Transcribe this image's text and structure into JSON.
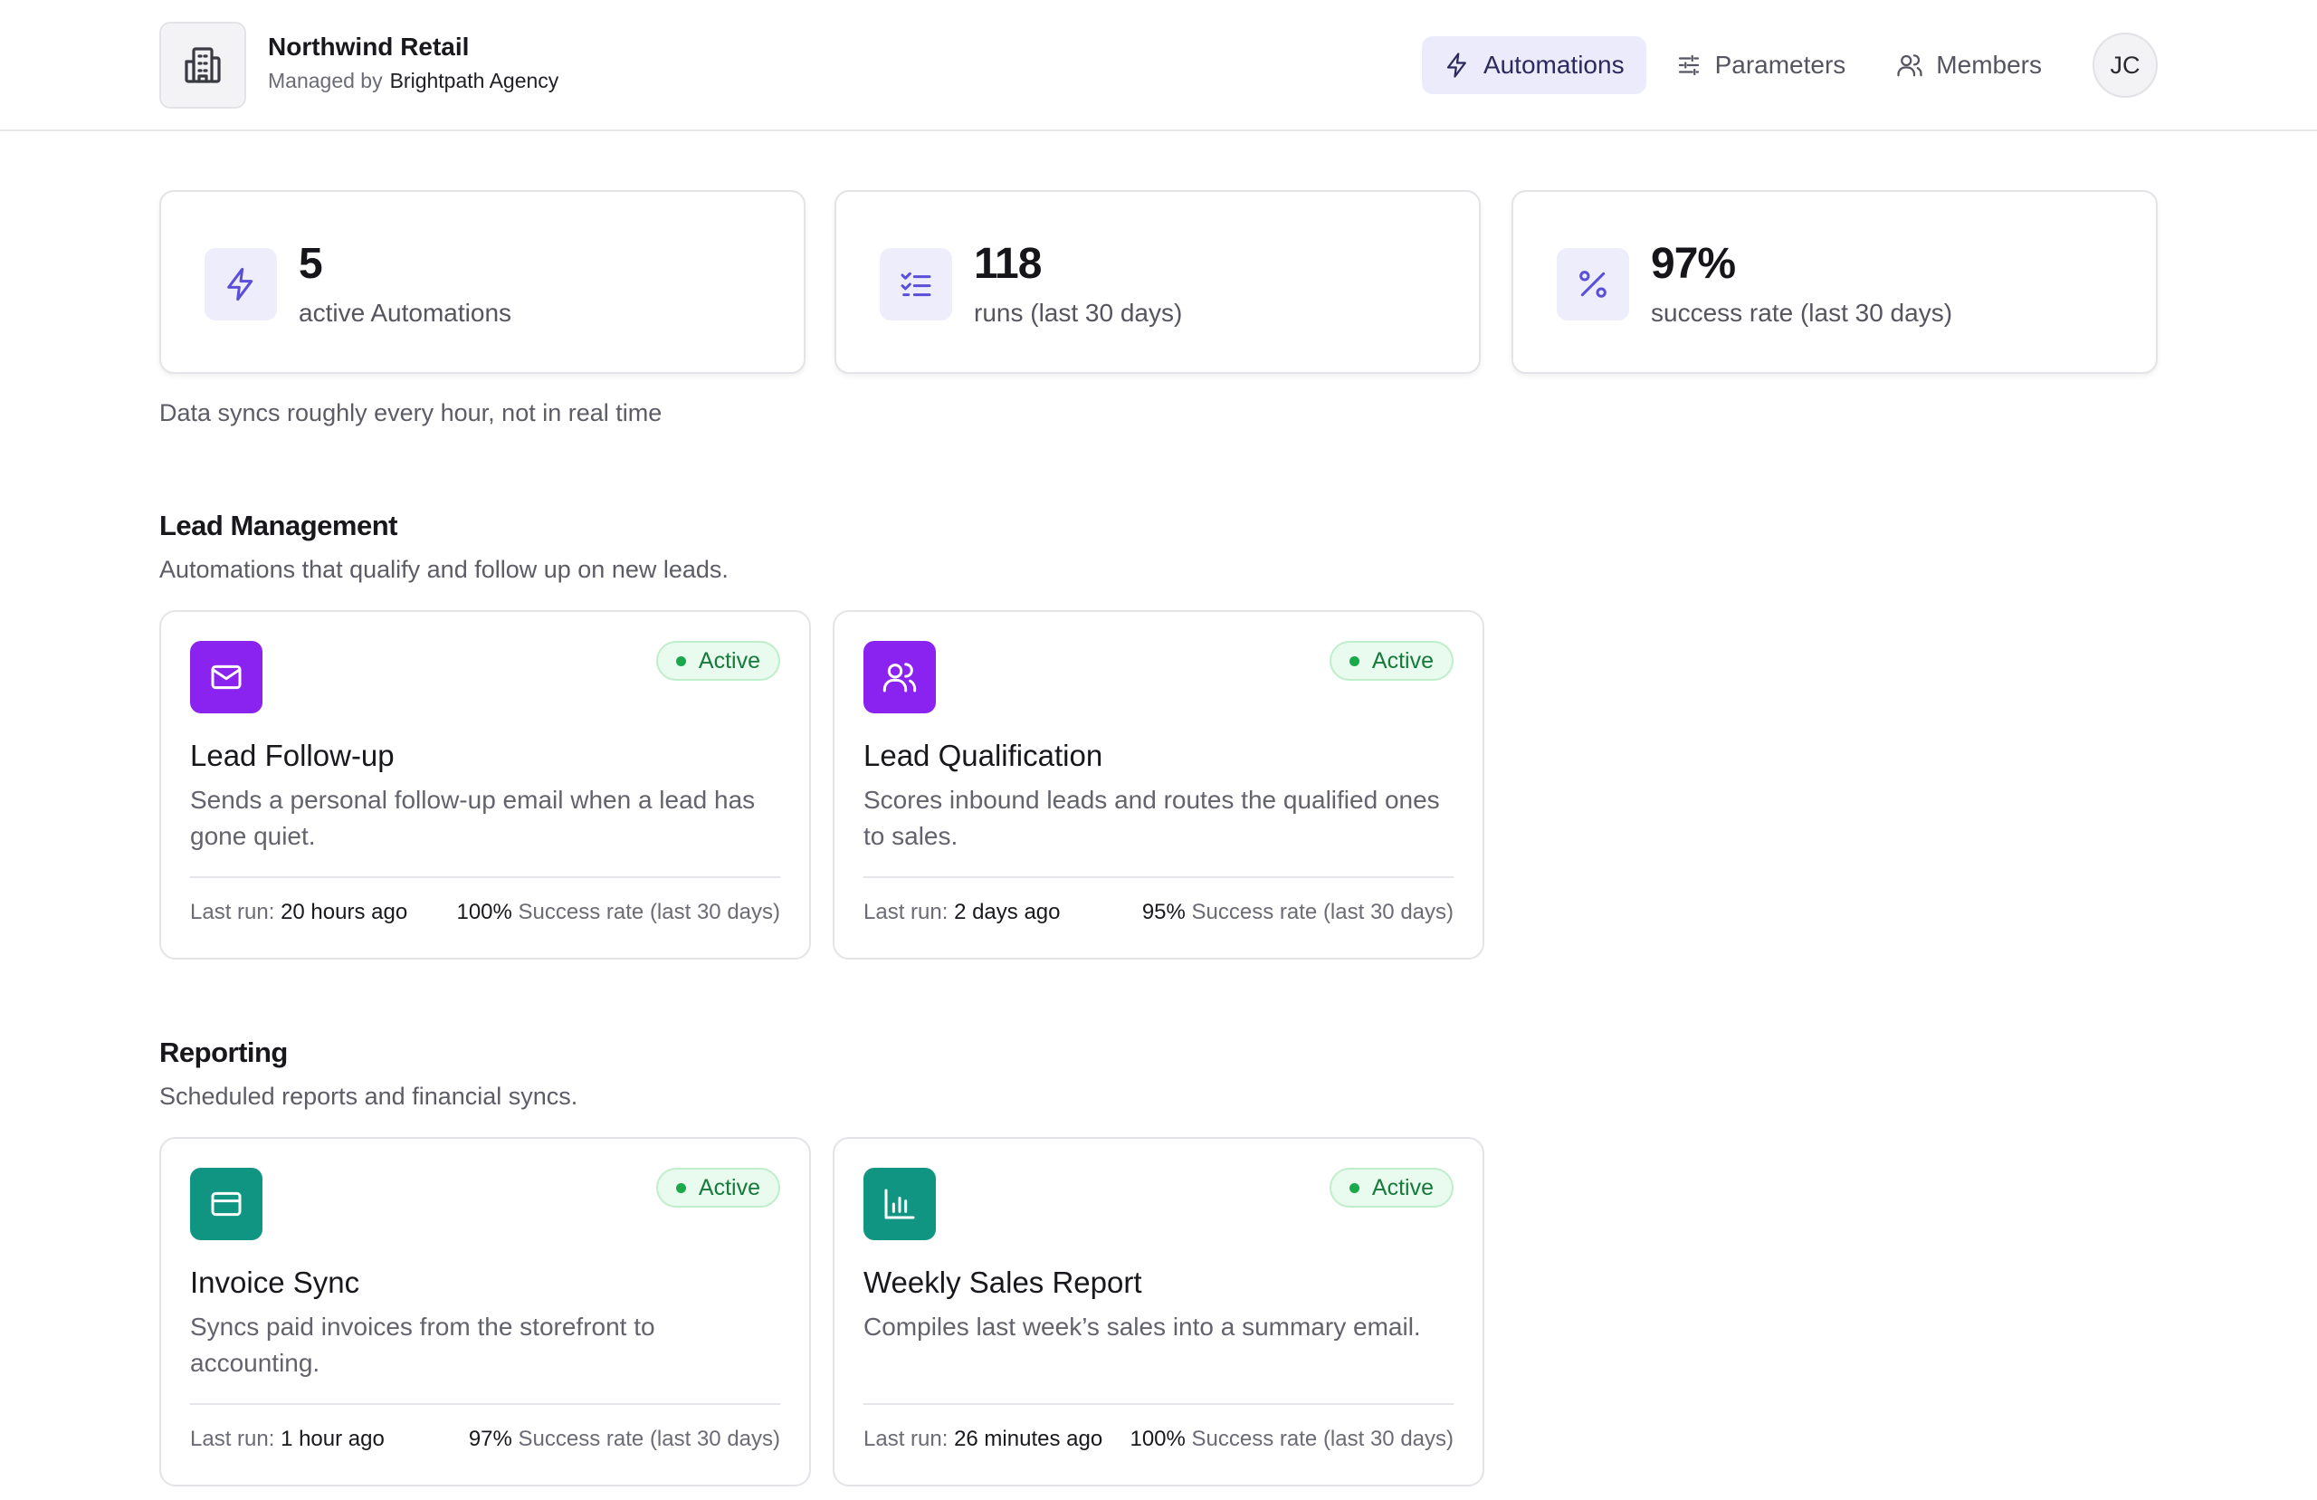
{
  "header": {
    "org_name": "Northwind Retail",
    "managed_by_label": "Managed by",
    "agency_name": "Brightpath Agency",
    "nav": [
      {
        "label": "Automations",
        "icon": "lightning-icon",
        "active": true
      },
      {
        "label": "Parameters",
        "icon": "sliders-icon",
        "active": false
      },
      {
        "label": "Members",
        "icon": "users-icon",
        "active": false
      }
    ],
    "avatar_initials": "JC"
  },
  "stats": [
    {
      "value": "5",
      "label": "active Automations",
      "icon": "lightning-icon"
    },
    {
      "value": "118",
      "label": "runs (last 30 days)",
      "icon": "checklist-icon"
    },
    {
      "value": "97%",
      "label": "success rate (last 30 days)",
      "icon": "percent-icon"
    }
  ],
  "sync_note": "Data syncs roughly every hour, not in real time",
  "sections": [
    {
      "title": "Lead Management",
      "description": "Automations that qualify and follow up on new leads.",
      "cards": [
        {
          "title": "Lead Follow-up",
          "description": "Sends a personal follow-up email when a lead has gone quiet.",
          "status": "Active",
          "icon": "mail-icon",
          "icon_color": "#8a22f0",
          "last_run_label": "Last run:",
          "last_run": "20 hours ago",
          "success_value": "100%",
          "success_label": "Success rate (last 30 days)"
        },
        {
          "title": "Lead Qualification",
          "description": "Scores inbound leads and routes the qualified ones to sales.",
          "status": "Active",
          "icon": "users-icon",
          "icon_color": "#8a22f0",
          "last_run_label": "Last run:",
          "last_run": "2 days ago",
          "success_value": "95%",
          "success_label": "Success rate (last 30 days)"
        }
      ]
    },
    {
      "title": "Reporting",
      "description": "Scheduled reports and financial syncs.",
      "cards": [
        {
          "title": "Invoice Sync",
          "description": "Syncs paid invoices from the storefront to accounting.",
          "status": "Active",
          "icon": "credit-card-icon",
          "icon_color": "#0f9582",
          "last_run_label": "Last run:",
          "last_run": "1 hour ago",
          "success_value": "97%",
          "success_label": "Success rate (last 30 days)"
        },
        {
          "title": "Weekly Sales Report",
          "description": "Compiles last week’s sales into a summary email.",
          "status": "Active",
          "icon": "bar-chart-icon",
          "icon_color": "#0f9582",
          "last_run_label": "Last run:",
          "last_run": "26 minutes ago",
          "success_value": "100%",
          "success_label": "Success rate (last 30 days)"
        }
      ]
    }
  ]
}
